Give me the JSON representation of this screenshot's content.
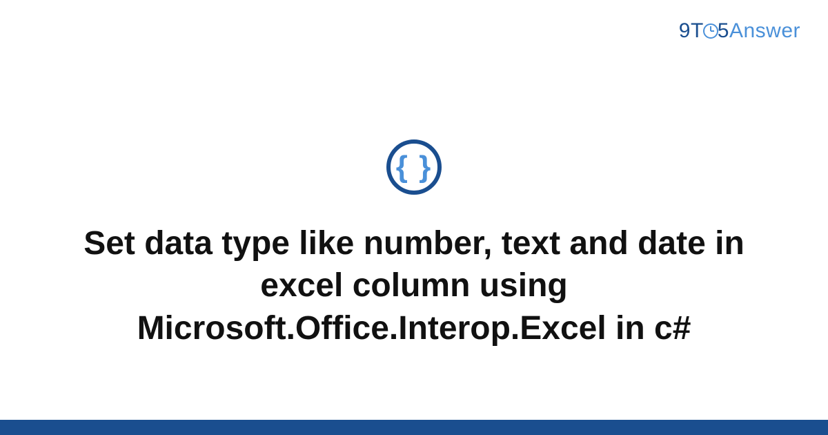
{
  "logo": {
    "nine": "9",
    "t": "T",
    "five": "5",
    "answer": "Answer"
  },
  "icon": {
    "glyph": "{ }"
  },
  "title": "Set data type like number, text and date in excel column using Microsoft.Office.Interop.Excel in c#",
  "colors": {
    "brand_dark": "#1a4e8f",
    "brand_light": "#4a90d9"
  }
}
